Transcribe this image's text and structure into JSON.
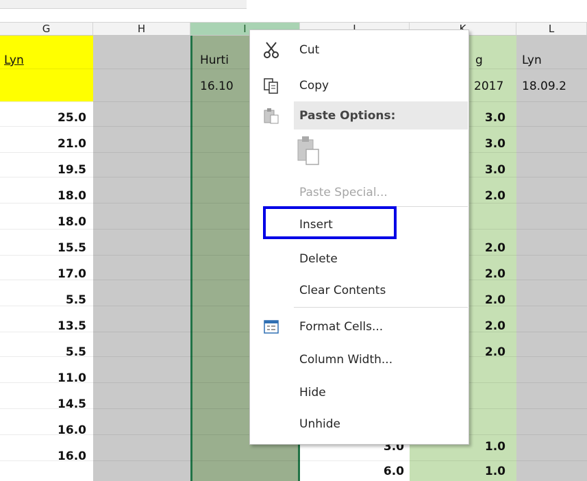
{
  "columns": [
    {
      "id": "G",
      "label": "G",
      "selected": false
    },
    {
      "id": "H",
      "label": "H",
      "selected": false
    },
    {
      "id": "I",
      "label": "I",
      "selected": true
    },
    {
      "id": "J",
      "label": "J",
      "selected": false
    },
    {
      "id": "K",
      "label": "K",
      "selected": false
    },
    {
      "id": "L",
      "label": "L",
      "selected": false
    }
  ],
  "cells": {
    "g_header": "Lyn",
    "i_header": "Hurti",
    "i_date": "16.10",
    "k_header": "g",
    "k_date": "2017",
    "l_header": "Lyn",
    "l_date": "18.09.2",
    "g_values": [
      "25.0",
      "21.0",
      "19.5",
      "18.0",
      "18.0",
      "15.5",
      "17.0",
      "5.5",
      "13.5",
      "5.5",
      "11.0",
      "14.5",
      "16.0",
      "16.0"
    ],
    "k_values": [
      "3.0",
      "3.0",
      "3.0",
      "2.0",
      "",
      "2.0",
      "2.0",
      "2.0",
      "2.0",
      "2.0",
      "",
      "",
      "1.0",
      "1.0"
    ],
    "j_values_partial": [
      "3.0",
      "6.0"
    ]
  },
  "context_menu": {
    "items": [
      {
        "label": "Cut",
        "icon": "scissors-icon",
        "enabled": true
      },
      {
        "label": "Copy",
        "icon": "copy-icon",
        "enabled": true
      },
      {
        "label": "Paste Options:",
        "icon": "paste-icon",
        "enabled": true
      },
      {
        "label": "",
        "icon": "paste-clipboard-icon",
        "enabled": true
      },
      {
        "label": "Paste Special...",
        "icon": "",
        "enabled": false
      },
      {
        "label": "Insert",
        "icon": "",
        "enabled": true
      },
      {
        "label": "Delete",
        "icon": "",
        "enabled": true
      },
      {
        "label": "Clear Contents",
        "icon": "",
        "enabled": true
      },
      {
        "label": "Format Cells...",
        "icon": "format-cells-icon",
        "enabled": true
      },
      {
        "label": "Column Width...",
        "icon": "",
        "enabled": true
      },
      {
        "label": "Hide",
        "icon": "",
        "enabled": true
      },
      {
        "label": "Unhide",
        "icon": "",
        "enabled": true
      }
    ]
  },
  "colors": {
    "g_header_fill": "#ffff00",
    "selected_column_fill": "#9aaf8e",
    "k_column_fill": "#c6e0b4",
    "h_column_fill": "#c9c9c9",
    "highlight_outline": "#0000e6"
  }
}
